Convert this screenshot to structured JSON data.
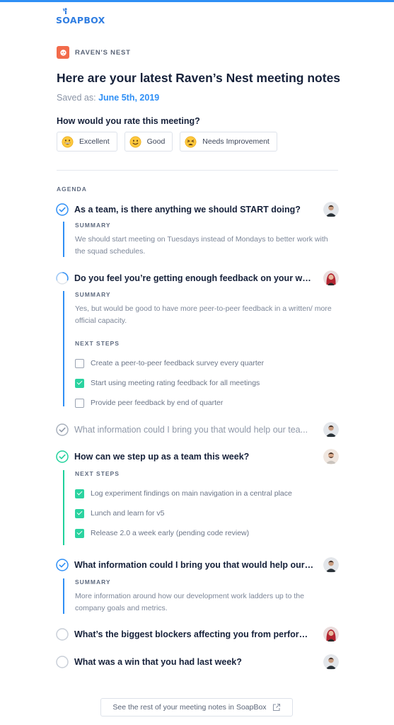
{
  "brand": {
    "logo_text": "SOAPBOX"
  },
  "team": {
    "name": "RAVEN'S NEST"
  },
  "header": {
    "title": "Here are your latest Raven’s Nest meeting notes",
    "saved_prefix": "Saved as:",
    "saved_date": "June 5th, 2019"
  },
  "rating": {
    "question": "How would you rate this meeting?",
    "options": [
      {
        "label": "Excellent",
        "icon": "grinning-face-icon"
      },
      {
        "label": "Good",
        "icon": "smiling-face-icon"
      },
      {
        "label": "Needs Improvement",
        "icon": "weary-face-icon"
      }
    ]
  },
  "agenda": {
    "label": "AGENDA",
    "items": [
      {
        "question": "As a team, is there anything we should START doing?",
        "status": "done-blue",
        "avatar": "man-avatar",
        "summary_label": "SUMMARY",
        "summary": "We should start meeting on Tuesdays instead of Mondays to better work with the squad schedules."
      },
      {
        "question": "Do you feel you’re getting enough feedback on your work?...",
        "status": "in-progress",
        "avatar": "woman-avatar",
        "summary_label": "SUMMARY",
        "summary": "Yes, but would be good to have more peer-to-peer feedback in a written/ more official capacity.",
        "next_steps_label": "NEXT STEPS",
        "steps": [
          {
            "text": "Create a peer-to-peer feedback survey every quarter",
            "checked": false
          },
          {
            "text": "Start using meeting rating feedback for all meetings",
            "checked": true
          },
          {
            "text": "Provide peer feedback by end of quarter",
            "checked": false
          }
        ]
      },
      {
        "question": "What information could I bring you that would help our tea...",
        "status": "done-gray",
        "avatar": "man-avatar"
      },
      {
        "question": "How can we step up as a team this week?",
        "status": "done-green",
        "avatar": "bearded-man-avatar",
        "next_steps_label": "NEXT STEPS",
        "steps": [
          {
            "text": "Log experiment findings on main navigation in a central place",
            "checked": true
          },
          {
            "text": "Lunch and learn for v5",
            "checked": true
          },
          {
            "text": "Release 2.0 a week early (pending code review)",
            "checked": true
          }
        ]
      },
      {
        "question": "What information could I bring you that would help our tea...",
        "status": "done-blue",
        "avatar": "man-avatar",
        "summary_label": "SUMMARY",
        "summary": "More information around how our development work ladders up to the company goals and metrics."
      },
      {
        "question": "What’s the biggest blockers affecting you from performin...",
        "status": "empty",
        "avatar": "woman-avatar"
      },
      {
        "question": "What was a win that you had last week?",
        "status": "empty",
        "avatar": "man-avatar"
      }
    ]
  },
  "footer": {
    "link_label": "See the rest of your meeting notes in SoapBox",
    "icon": "external-link-icon"
  },
  "colors": {
    "accent": "#2f8ff5",
    "green": "#1fd19b",
    "badge": "#f26b4b",
    "text": "#16213a"
  }
}
